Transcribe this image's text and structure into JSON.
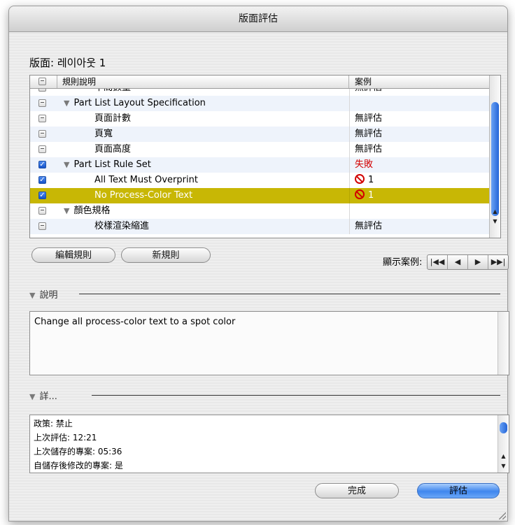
{
  "window": {
    "title": "版面評估"
  },
  "layout_title": "版面: 레이아웃 1",
  "table": {
    "columns": {
      "rule": "規則說明",
      "case": "案例"
    },
    "rows": [
      {
        "label": "中間數量",
        "case": "無評估",
        "indent": 2,
        "check": "part",
        "tri": false
      },
      {
        "label": "Part List Layout Specification",
        "case": "",
        "indent": 1,
        "check": "part",
        "tri": true
      },
      {
        "label": "頁面計數",
        "case": "無評估",
        "indent": 2,
        "check": "part",
        "tri": false
      },
      {
        "label": "頁寬",
        "case": "無評估",
        "indent": 2,
        "check": "part",
        "tri": false
      },
      {
        "label": "頁面高度",
        "case": "無評估",
        "indent": 2,
        "check": "part",
        "tri": false
      },
      {
        "label": "Part List Rule Set",
        "case": "失敗",
        "indent": 1,
        "check": "on",
        "tri": true,
        "fail": true
      },
      {
        "label": "All Text Must Overprint",
        "case": "1",
        "indent": 2,
        "check": "on",
        "tri": false,
        "noicon": true
      },
      {
        "label": "No Process-Color Text",
        "case": "1",
        "indent": 2,
        "check": "on",
        "tri": false,
        "noicon": true,
        "selected": true
      },
      {
        "label": "顏色規格",
        "case": "",
        "indent": 1,
        "check": "part",
        "tri": true
      },
      {
        "label": "校樣渲染縮進",
        "case": "無評估",
        "indent": 2,
        "check": "part",
        "tri": false
      }
    ]
  },
  "buttons": {
    "edit_rule": "編輯規則",
    "new_rule": "新規則",
    "done": "完成",
    "evaluate": "評估"
  },
  "show_cases_label": "顯示案例:",
  "nav": [
    "|◀◀",
    "◀",
    "▶",
    "▶▶|"
  ],
  "description": {
    "heading": "說明",
    "text": "Change all process-color text to a spot color"
  },
  "details": {
    "heading": "詳...",
    "lines": [
      "政策: 禁止",
      "上次評估: 12:21",
      "上次儲存的專案: 05:36",
      "自儲存後修改的專案: 是"
    ]
  }
}
